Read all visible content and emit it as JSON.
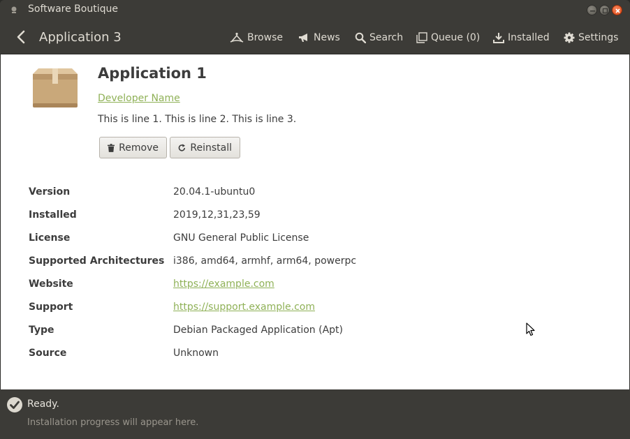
{
  "window": {
    "title": "Software Boutique",
    "controls": [
      "minimize-icon",
      "maximize-icon",
      "close-icon"
    ],
    "close_color": "#df4a16"
  },
  "header": {
    "title": "Application 3",
    "nav": {
      "browse": "Browse",
      "news": "News",
      "search": "Search",
      "queue": "Queue (0)",
      "installed": "Installed",
      "settings": "Settings"
    }
  },
  "app": {
    "name": "Application 1",
    "developer": "Developer Name",
    "description": "This is line 1. This is line 2. This is line 3.",
    "icon": "package-box-icon"
  },
  "actions": {
    "remove": "Remove",
    "reinstall": "Reinstall"
  },
  "details": [
    {
      "label": "Version",
      "value": "20.04.1-ubuntu0"
    },
    {
      "label": "Installed",
      "value": "2019,12,31,23,59"
    },
    {
      "label": "License",
      "value": "GNU General Public License"
    },
    {
      "label": "Supported Architectures",
      "value": "i386, amd64, armhf, arm64, powerpc"
    },
    {
      "label": "Website",
      "value": "https://example.com"
    },
    {
      "label": "Support",
      "value": "https://support.example.com"
    },
    {
      "label": "Type",
      "value": "Debian Packaged Application (Apt)"
    },
    {
      "label": "Source",
      "value": "Unknown"
    }
  ],
  "status": {
    "text": "Ready.",
    "subtext": "Installation progress will appear here."
  },
  "colors": {
    "accent_link": "#8fb157",
    "header_bg": "#3c3b37",
    "content_bg": "#ffffff"
  }
}
